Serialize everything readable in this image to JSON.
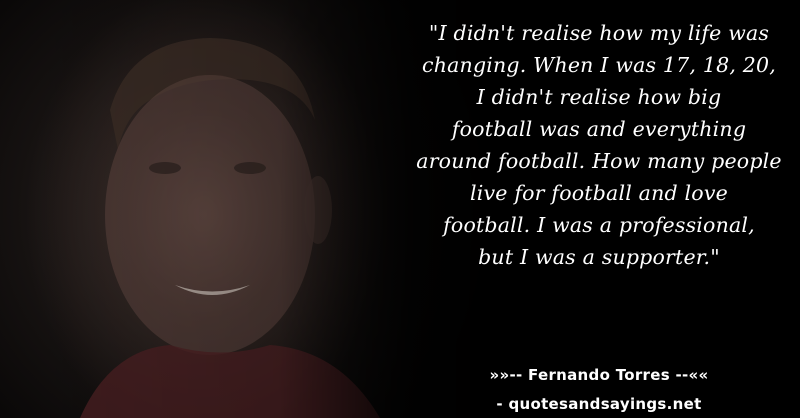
{
  "quote": {
    "lines": [
      "\"I didn't realise how my life was",
      "changing. When I was 17, 18, 20,",
      "I didn't realise how big",
      "football was and everything",
      "around football. How many people",
      "live for football and love",
      "football. I was a professional,",
      "but I was a supporter.\""
    ]
  },
  "attribution": "»»-- Fernando Torres --««",
  "source": "- quotesandsayings.net"
}
